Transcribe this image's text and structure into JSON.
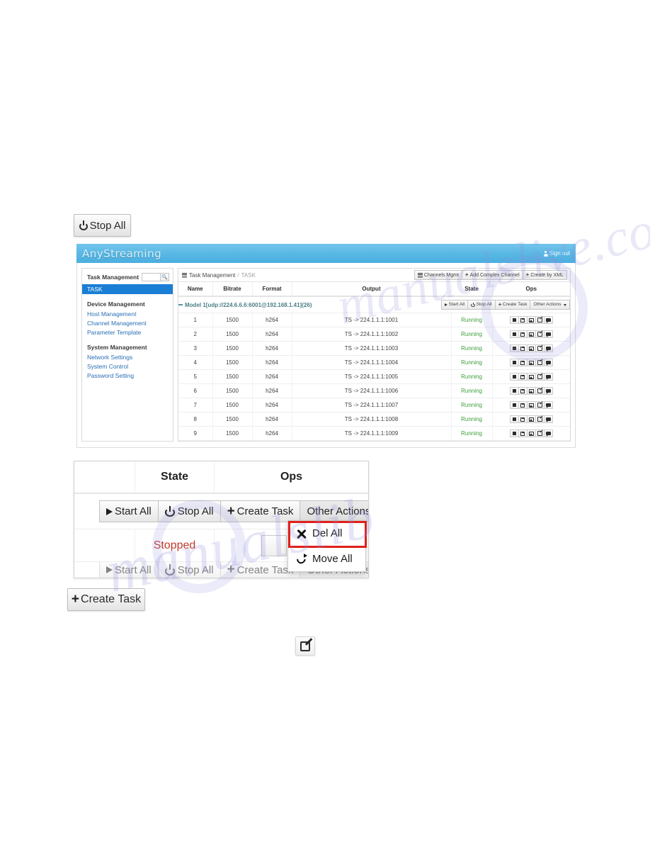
{
  "callouts": {
    "stop_all": {
      "label": "Stop All",
      "icon": "power-icon"
    },
    "create_task": {
      "label": "Create Task",
      "icon": "plus-icon"
    },
    "edit_icon": {
      "icon": "edit-square-icon"
    }
  },
  "watermark": {
    "line1": "manualslib",
    "line2": "manualslive.com"
  },
  "app": {
    "header": {
      "logo": "AnyStreaming",
      "signout": "Sign out",
      "signout_icon": "user-icon"
    },
    "sidebar": {
      "search": {
        "value": "",
        "placeholder": "",
        "icon": "search-icon"
      },
      "groups": [
        {
          "title": "Task Management",
          "items": [
            {
              "label": "TASK",
              "active": true
            }
          ]
        },
        {
          "title": "Device Management",
          "items": [
            {
              "label": "Host Management",
              "active": false
            },
            {
              "label": "Channel Management",
              "active": false
            },
            {
              "label": "Parameter Template",
              "active": false
            }
          ]
        },
        {
          "title": "System Management",
          "items": [
            {
              "label": "Network Settings",
              "active": false
            },
            {
              "label": "System Control",
              "active": false
            },
            {
              "label": "Password Setting",
              "active": false
            }
          ]
        }
      ]
    },
    "breadcrumb": {
      "icon": "grid-icon",
      "root": "Task Management",
      "separator": "/",
      "current": "TASK"
    },
    "toolbar_buttons": [
      {
        "label": "Channels Mgmt",
        "icon": "list-icon"
      },
      {
        "label": "Add Complex Channel",
        "icon": "plus-icon"
      },
      {
        "label": "Create by XML",
        "icon": "plus-icon"
      }
    ],
    "table": {
      "columns": [
        "Name",
        "Bitrate",
        "Format",
        "Output",
        "State",
        "Ops"
      ],
      "group_row": {
        "label": "Model 1[udp://224.6.6.6:6001@192.168.1.41](26)",
        "buttons": [
          {
            "label": "Start All",
            "icon": "play-icon"
          },
          {
            "label": "Stop All",
            "icon": "power-icon"
          },
          {
            "label": "Create Task",
            "icon": "plus-icon"
          },
          {
            "label": "Other Actions",
            "icon": "caret-down-icon"
          }
        ]
      },
      "ops_icons": [
        "stop-icon",
        "save-icon",
        "image-icon",
        "edit-icon",
        "chat-icon"
      ],
      "rows": [
        {
          "name": "1",
          "bitrate": "1500",
          "format": "h264",
          "output": "TS -> 224.1.1.1:1001",
          "state": "Running"
        },
        {
          "name": "2",
          "bitrate": "1500",
          "format": "h264",
          "output": "TS -> 224.1.1.1:1002",
          "state": "Running"
        },
        {
          "name": "3",
          "bitrate": "1500",
          "format": "h264",
          "output": "TS -> 224.1.1.1:1003",
          "state": "Running"
        },
        {
          "name": "4",
          "bitrate": "1500",
          "format": "h264",
          "output": "TS -> 224.1.1.1:1004",
          "state": "Running"
        },
        {
          "name": "5",
          "bitrate": "1500",
          "format": "h264",
          "output": "TS -> 224.1.1.1:1005",
          "state": "Running"
        },
        {
          "name": "6",
          "bitrate": "1500",
          "format": "h264",
          "output": "TS -> 224.1.1.1:1006",
          "state": "Running"
        },
        {
          "name": "7",
          "bitrate": "1500",
          "format": "h264",
          "output": "TS -> 224.1.1.1:1007",
          "state": "Running"
        },
        {
          "name": "8",
          "bitrate": "1500",
          "format": "h264",
          "output": "TS -> 224.1.1.1:1008",
          "state": "Running"
        },
        {
          "name": "9",
          "bitrate": "1500",
          "format": "h264",
          "output": "TS -> 224.1.1.1:1009",
          "state": "Running"
        }
      ]
    }
  },
  "zoom_panel": {
    "columns": {
      "c2": "State",
      "c3": "Ops"
    },
    "toolbar": [
      {
        "label": "Start All",
        "icon": "play-icon"
      },
      {
        "label": "Stop All",
        "icon": "power-icon"
      },
      {
        "label": "Create Task",
        "icon": "plus-icon"
      },
      {
        "label": "Other Actions",
        "icon": "caret-down-icon"
      }
    ],
    "row_state": "Stopped",
    "dropdown": {
      "items": [
        {
          "label": "Del All",
          "icon": "x-icon",
          "highlighted": true
        },
        {
          "label": "Move All",
          "icon": "move-icon",
          "highlighted": false
        }
      ],
      "highlight_color": "#e0201b"
    }
  },
  "colors": {
    "brand_header": "#58b7e4",
    "active_nav": "#1a7fd4",
    "link": "#2a6fb5",
    "running": "#3c9e3c",
    "stopped": "#c0392b",
    "highlight": "#e0201b"
  }
}
